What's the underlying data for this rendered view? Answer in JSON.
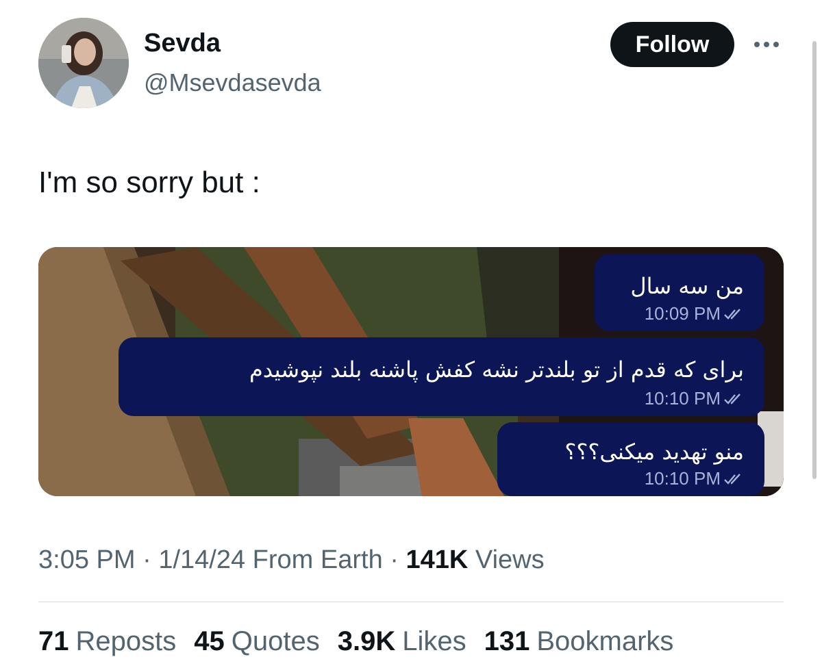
{
  "user": {
    "display_name": "Sevda",
    "handle": "@Msevdasevda",
    "follow_label": "Follow"
  },
  "tweet": {
    "text": "I'm so sorry but :"
  },
  "media": {
    "messages": [
      {
        "text": "من سه سال",
        "time": "10:09 PM"
      },
      {
        "text": "برای که قدم از تو بلندتر نشه کفش پاشنه بلند نپوشیدم",
        "time": "10:10 PM"
      },
      {
        "text": "منو تهدید میکنی؟؟؟",
        "time": "10:10 PM"
      }
    ],
    "bubble_color": "#0c1656"
  },
  "meta": {
    "time": "3:05 PM",
    "date": "1/14/24",
    "source": "From Earth",
    "views_count": "141K",
    "views_label": "Views"
  },
  "stats": {
    "reposts_count": "71",
    "reposts_label": "Reposts",
    "quotes_count": "45",
    "quotes_label": "Quotes",
    "likes_count": "3.9K",
    "likes_label": "Likes",
    "bookmarks_count": "131",
    "bookmarks_label": "Bookmarks"
  },
  "icons": {
    "more": "more-horizontal-icon",
    "read_receipt": "double-check-icon"
  }
}
